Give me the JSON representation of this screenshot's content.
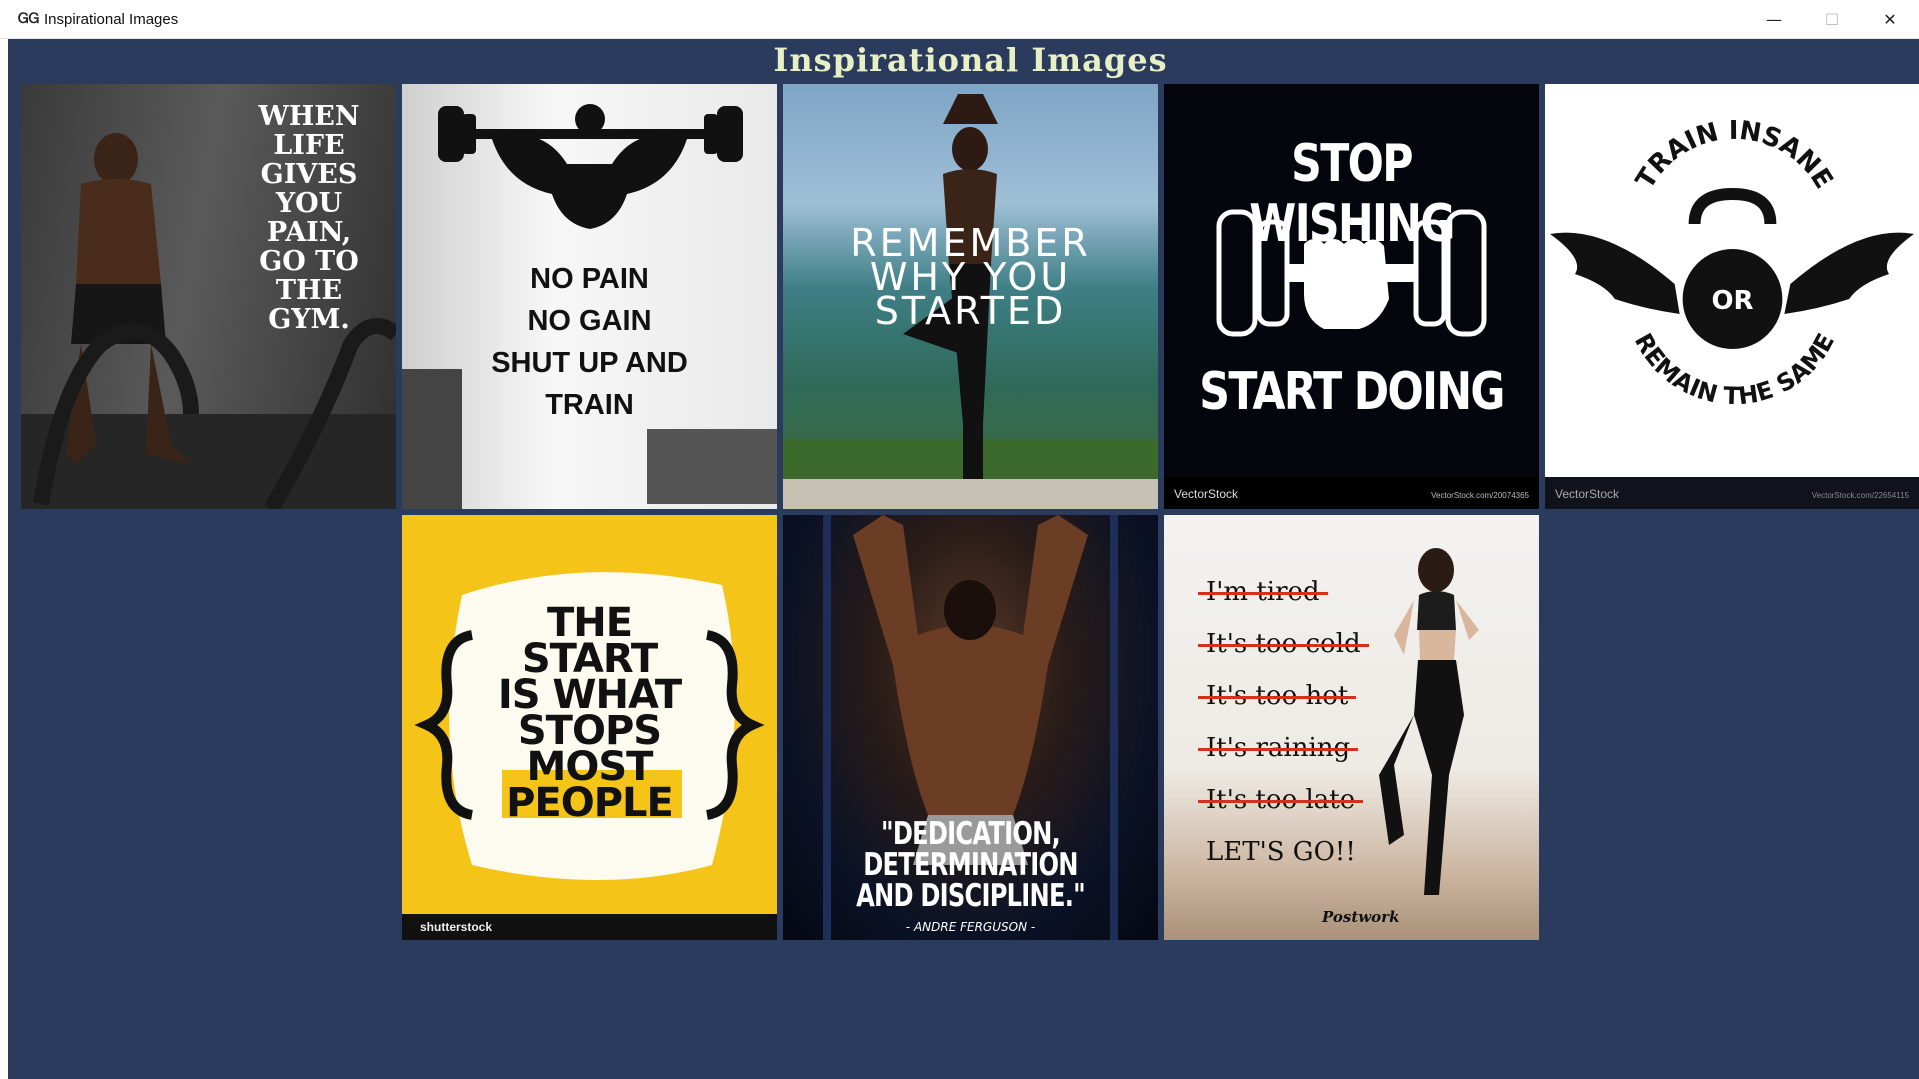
{
  "window": {
    "icon_glyph": "ᏀᏀ",
    "title": "Inspirational Images",
    "controls": {
      "minimize": "—",
      "maximize": "☐",
      "close": "✕"
    }
  },
  "heading": "Inspirational Images",
  "tiles": [
    {
      "caption": "WHEN\nLIFE\nGIVES\nYOU\nPAIN,\nGO TO\nTHE\nGYM."
    },
    {
      "caption": "NO PAIN\nNO GAIN\nSHUT UP AND\nTRAIN"
    },
    {
      "caption": "REMEMBER\nWHY YOU\nSTARTED"
    },
    {
      "top": "STOP WISHING",
      "bottom": "START DOING",
      "watermark_left": "VectorStock",
      "watermark_right": "VectorStock.com/20074365"
    },
    {
      "top_arc": "TRAIN INSANE",
      "center": "OR",
      "bottom_arc": "REMAIN THE SAME",
      "watermark_left": "VectorStock",
      "watermark_right": "VectorStock.com/22654115"
    },
    {
      "caption": "THE\nSTART\nIS WHAT\nSTOPS\nMOST\nPEOPLE",
      "watermark_left": "shutterstock"
    },
    {
      "caption": "\"DEDICATION, DETERMINATION\nAND DISCIPLINE.\"",
      "author": "- ANDRE FERGUSON -"
    },
    {
      "excuses": [
        "I'm tired",
        "It's too cold",
        "It's too hot",
        "It's raining",
        "It's too late"
      ],
      "final": "LET'S GO!!",
      "logo": "Postwork"
    }
  ],
  "colors": {
    "client_background": "#2a3b5e",
    "heading_text": "#e8efc4",
    "strike_red": "#d5301f",
    "poster_yellow": "#f5c418"
  }
}
